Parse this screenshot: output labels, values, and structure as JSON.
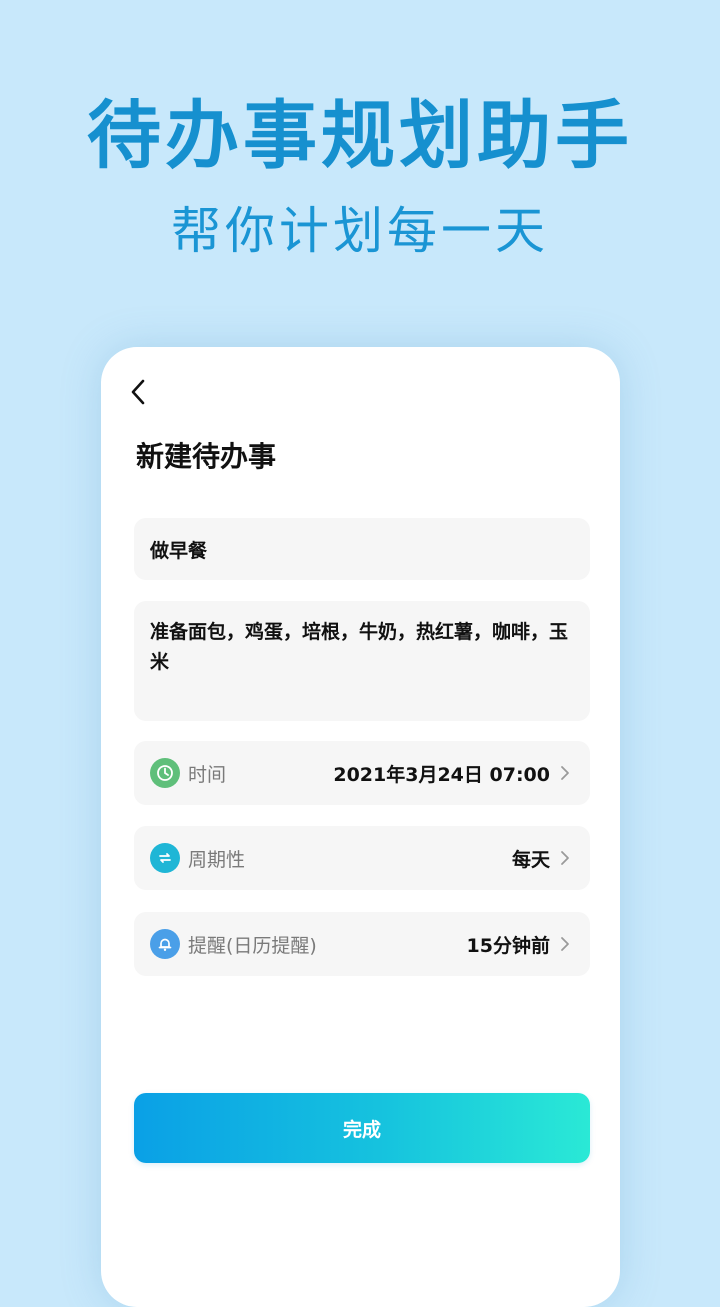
{
  "promo": {
    "title": "待办事规划助手",
    "subtitle": "帮你计划每一天"
  },
  "header": {
    "back_icon": "chevron-left-icon",
    "title": "新建待办事"
  },
  "form": {
    "title_value": "做早餐",
    "description_value": "准备面包，鸡蛋，培根，牛奶，热红薯，咖啡，玉米",
    "rows": [
      {
        "icon": "clock-icon",
        "label": "时间",
        "value": "2021年3月24日 07:00",
        "icon_color": "#5fbf7a"
      },
      {
        "icon": "repeat-icon",
        "label": "周期性",
        "value": "每天",
        "icon_color": "#1fb6d6"
      },
      {
        "icon": "bell-icon",
        "label": "提醒(日历提醒)",
        "value": "15分钟前",
        "icon_color": "#4a9fe8"
      }
    ],
    "submit_label": "完成"
  },
  "colors": {
    "background": "#c8e8fb",
    "promo_text": "#1690cf",
    "button_gradient_start": "#0aa0e6",
    "button_gradient_end": "#2ae9d6"
  }
}
